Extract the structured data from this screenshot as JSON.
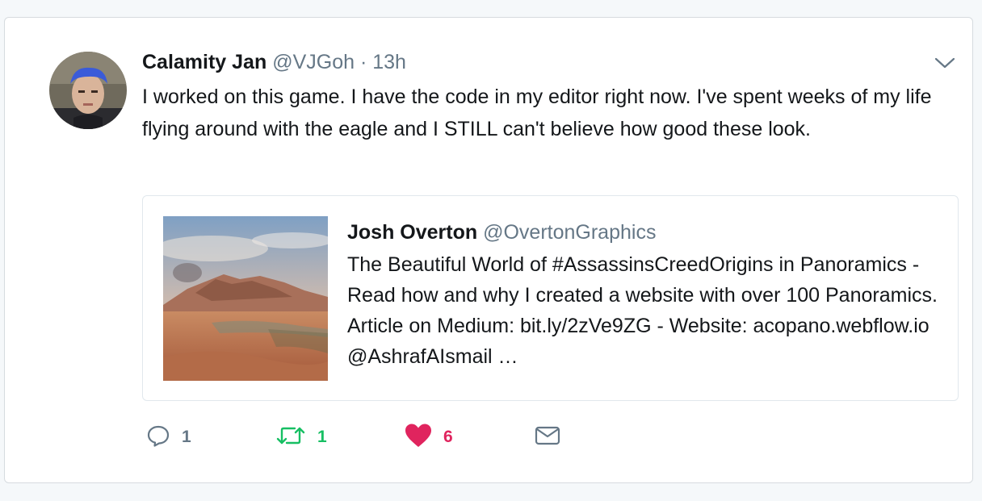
{
  "tweet": {
    "author_name": "Calamity Jan",
    "author_handle": "@VJGoh",
    "separator": "·",
    "time": "13h",
    "text": "I worked on this game. I have the code in my editor right now. I've spent weeks of my life flying around with the eagle and I STILL can't believe how good these look."
  },
  "quoted_tweet": {
    "author_name": "Josh Overton",
    "author_handle": "@OvertonGraphics",
    "text": "The Beautiful World of #AssassinsCreedOrigins in Panoramics - Read how and why I created a website with over 100 Panoramics. Article on Medium: bit.ly/2zVe9ZG - Website: acopano.webflow.io @AshrafAIsmail …"
  },
  "actions": {
    "reply_count": "1",
    "retweet_count": "1",
    "like_count": "6"
  },
  "colors": {
    "retweet": "#17bf63",
    "like": "#e0245e",
    "muted": "#657786",
    "text": "#14171a"
  },
  "icons": {
    "reply": "reply-icon",
    "retweet": "retweet-icon",
    "like": "heart-icon",
    "dm": "envelope-icon",
    "menu": "chevron-down-icon"
  }
}
